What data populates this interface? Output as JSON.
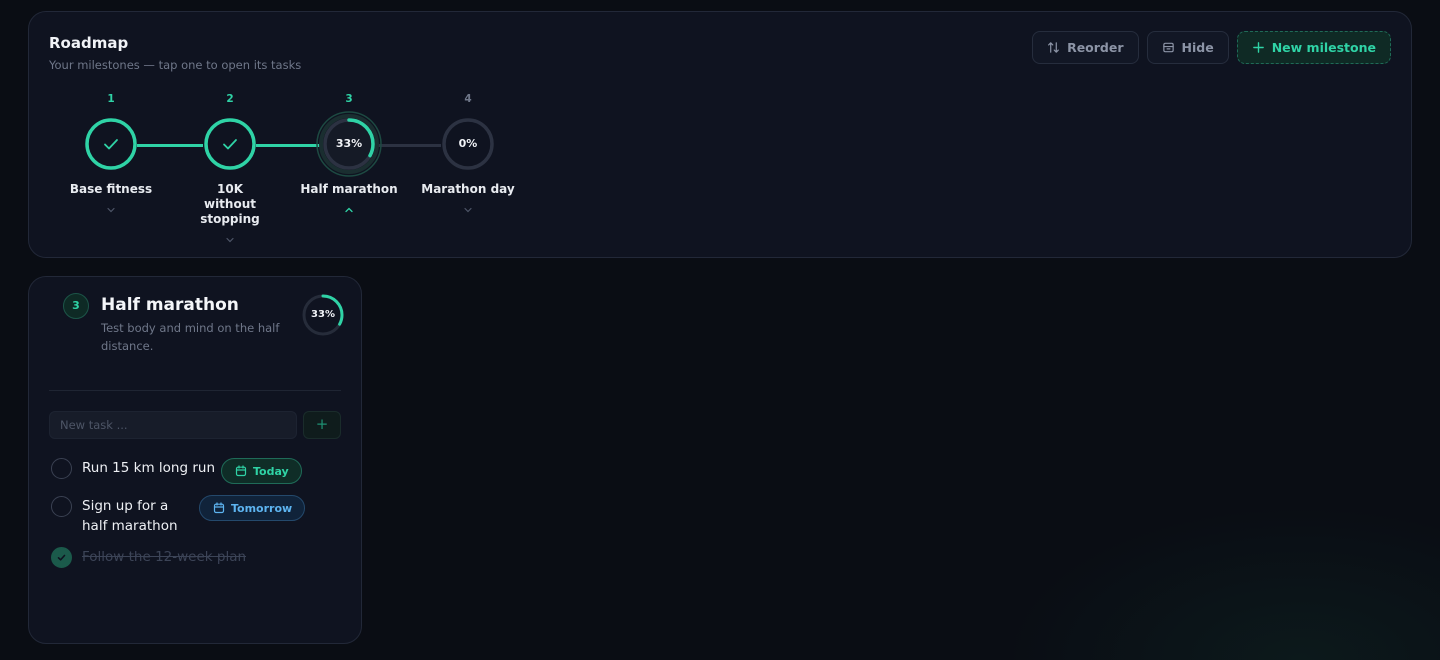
{
  "roadmap": {
    "title": "Roadmap",
    "subtitle": "Your milestones — tap one to open its tasks",
    "actions": {
      "reorder": "Reorder",
      "hide": "Hide",
      "new_milestone": "New milestone"
    },
    "milestones": [
      {
        "number": "1",
        "label": "Base fitness",
        "status": "completed",
        "progress": 1.0
      },
      {
        "number": "2",
        "label": "10K without stopping",
        "status": "completed",
        "progress": 1.0
      },
      {
        "number": "3",
        "label": "Half marathon",
        "status": "active",
        "progress": 0.33,
        "progress_label": "33%"
      },
      {
        "number": "4",
        "label": "Marathon day",
        "status": "upcoming",
        "progress": 0.0,
        "progress_label": "0%"
      }
    ]
  },
  "detail": {
    "number": "3",
    "title": "Half marathon",
    "description": "Test body and mind on the half distance.",
    "progress": 0.33,
    "progress_label": "33%",
    "new_task_placeholder": "New task ...",
    "add_icon": "plus-icon",
    "tasks": [
      {
        "text": "Run 15 km long run",
        "done": false,
        "due": "Today"
      },
      {
        "text": "Sign up for a half marathon",
        "done": false,
        "due": "Tomorrow"
      },
      {
        "text": "Follow the 12-week plan",
        "done": true
      }
    ]
  },
  "colors": {
    "accent": "#2fd3a6",
    "accent_dim": "#1b5a4b",
    "track": "#2c3242",
    "card": "#0f1320",
    "background": "#0a0d14",
    "tomorrow": "#5db4f0"
  }
}
